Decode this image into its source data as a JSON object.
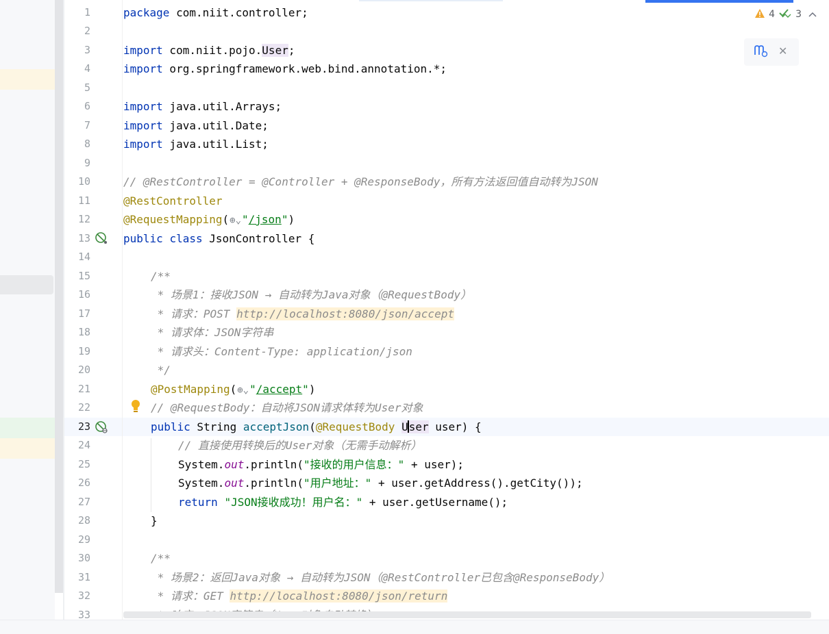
{
  "inspections": {
    "warnings": "4",
    "weak_warnings": "3"
  },
  "gutter": {
    "line_numbers": [
      "1",
      "2",
      "3",
      "4",
      "5",
      "6",
      "7",
      "8",
      "9",
      "10",
      "11",
      "12",
      "13",
      "14",
      "15",
      "16",
      "17",
      "18",
      "19",
      "20",
      "21",
      "22",
      "23",
      "24",
      "25",
      "26",
      "27",
      "28",
      "29",
      "30",
      "31",
      "32",
      "33"
    ],
    "current_line": "23"
  },
  "code": {
    "l1": {
      "kw": "package",
      "rest": " com.niit.controller;"
    },
    "l3": {
      "kw": "import",
      "pre": " com.niit.pojo.",
      "usage": "User",
      "post": ";"
    },
    "l4": {
      "kw": "import",
      "rest": " org.springframework.web.bind.annotation.*;"
    },
    "l6": {
      "kw": "import",
      "rest": " java.util.Arrays;"
    },
    "l7": {
      "kw": "import",
      "rest": " java.util.Date;"
    },
    "l8": {
      "kw": "import",
      "rest": " java.util.List;"
    },
    "l10": {
      "comment": "// @RestController = @Controller + @ResponseBody，所有方法返回值自动转为JSON"
    },
    "l11": {
      "ann": "@RestController"
    },
    "l12": {
      "ann": "@RequestMapping",
      "open": "(",
      "q1": "\"",
      "url": "/json",
      "q2": "\"",
      "close": ")"
    },
    "l13": {
      "kw1": "public",
      "kw2": "class",
      "rest": " JsonController {"
    },
    "l15": {
      "comment": "/**"
    },
    "l16": {
      "comment": " * 场景1：接收JSON → 自动转为Java对象（@RequestBody）"
    },
    "l17": {
      "comment": " * 请求：POST ",
      "url": "http://localhost:8080/json/accept"
    },
    "l18": {
      "comment": " * 请求体：JSON字符串"
    },
    "l19": {
      "comment": " * 请求头：Content-Type: application/json"
    },
    "l20": {
      "comment": " */"
    },
    "l21": {
      "ann": "@PostMapping",
      "open": "(",
      "q1": "\"",
      "url": "/accept",
      "q2": "\"",
      "close": ")"
    },
    "l22": {
      "comment": "// @RequestBody：自动将JSON请求体转为User对象"
    },
    "l23": {
      "kw": "public",
      "type": " String ",
      "method": "acceptJson",
      "open": "(",
      "ann": "@RequestBody",
      "sp": " ",
      "usage_a": "U",
      "usage_b": "ser",
      "rest": " user) {"
    },
    "l24": {
      "comment": "// 直接使用转换后的User对象（无需手动解析）"
    },
    "l25": {
      "pre": "System.",
      "static": "out",
      "mid": ".println(",
      "str": "\"接收的用户信息：\"",
      "rest": " + user);"
    },
    "l26": {
      "pre": "System.",
      "static": "out",
      "mid": ".println(",
      "str": "\"用户地址：\"",
      "rest": " + user.getAddress().getCity());"
    },
    "l27": {
      "kw": "return",
      "sp": " ",
      "str": "\"JSON接收成功！用户名：\"",
      "rest": " + user.getUsername();"
    },
    "l28": {
      "rest": "}"
    },
    "l30": {
      "comment": "/**"
    },
    "l31": {
      "comment": " * 场景2：返回Java对象 → 自动转为JSON（@RestController已包含@ResponseBody）"
    },
    "l32": {
      "comment": " * 请求：GET ",
      "url": "http://localhost:8080/json/return"
    },
    "l33": {
      "comment": " * 响应：JSON字符串（User对象自动转换）"
    }
  },
  "icons": {
    "warning": "warning-triangle-icon",
    "weak_warning": "double-check-icon",
    "expand": "chevron-up-icon",
    "bean": "spring-bean-icon",
    "endpoint": "web-endpoint-icon",
    "intention": "lightbulb-icon",
    "globe": "globe-icon",
    "ai": "ai-assistant-icon",
    "close": "close-icon"
  },
  "colors": {
    "keyword": "#0033b3",
    "annotation": "#9e880d",
    "string": "#067d17",
    "comment": "#8c8c8c",
    "method": "#00627a",
    "static_field": "#871094",
    "accent": "#3574f0"
  }
}
